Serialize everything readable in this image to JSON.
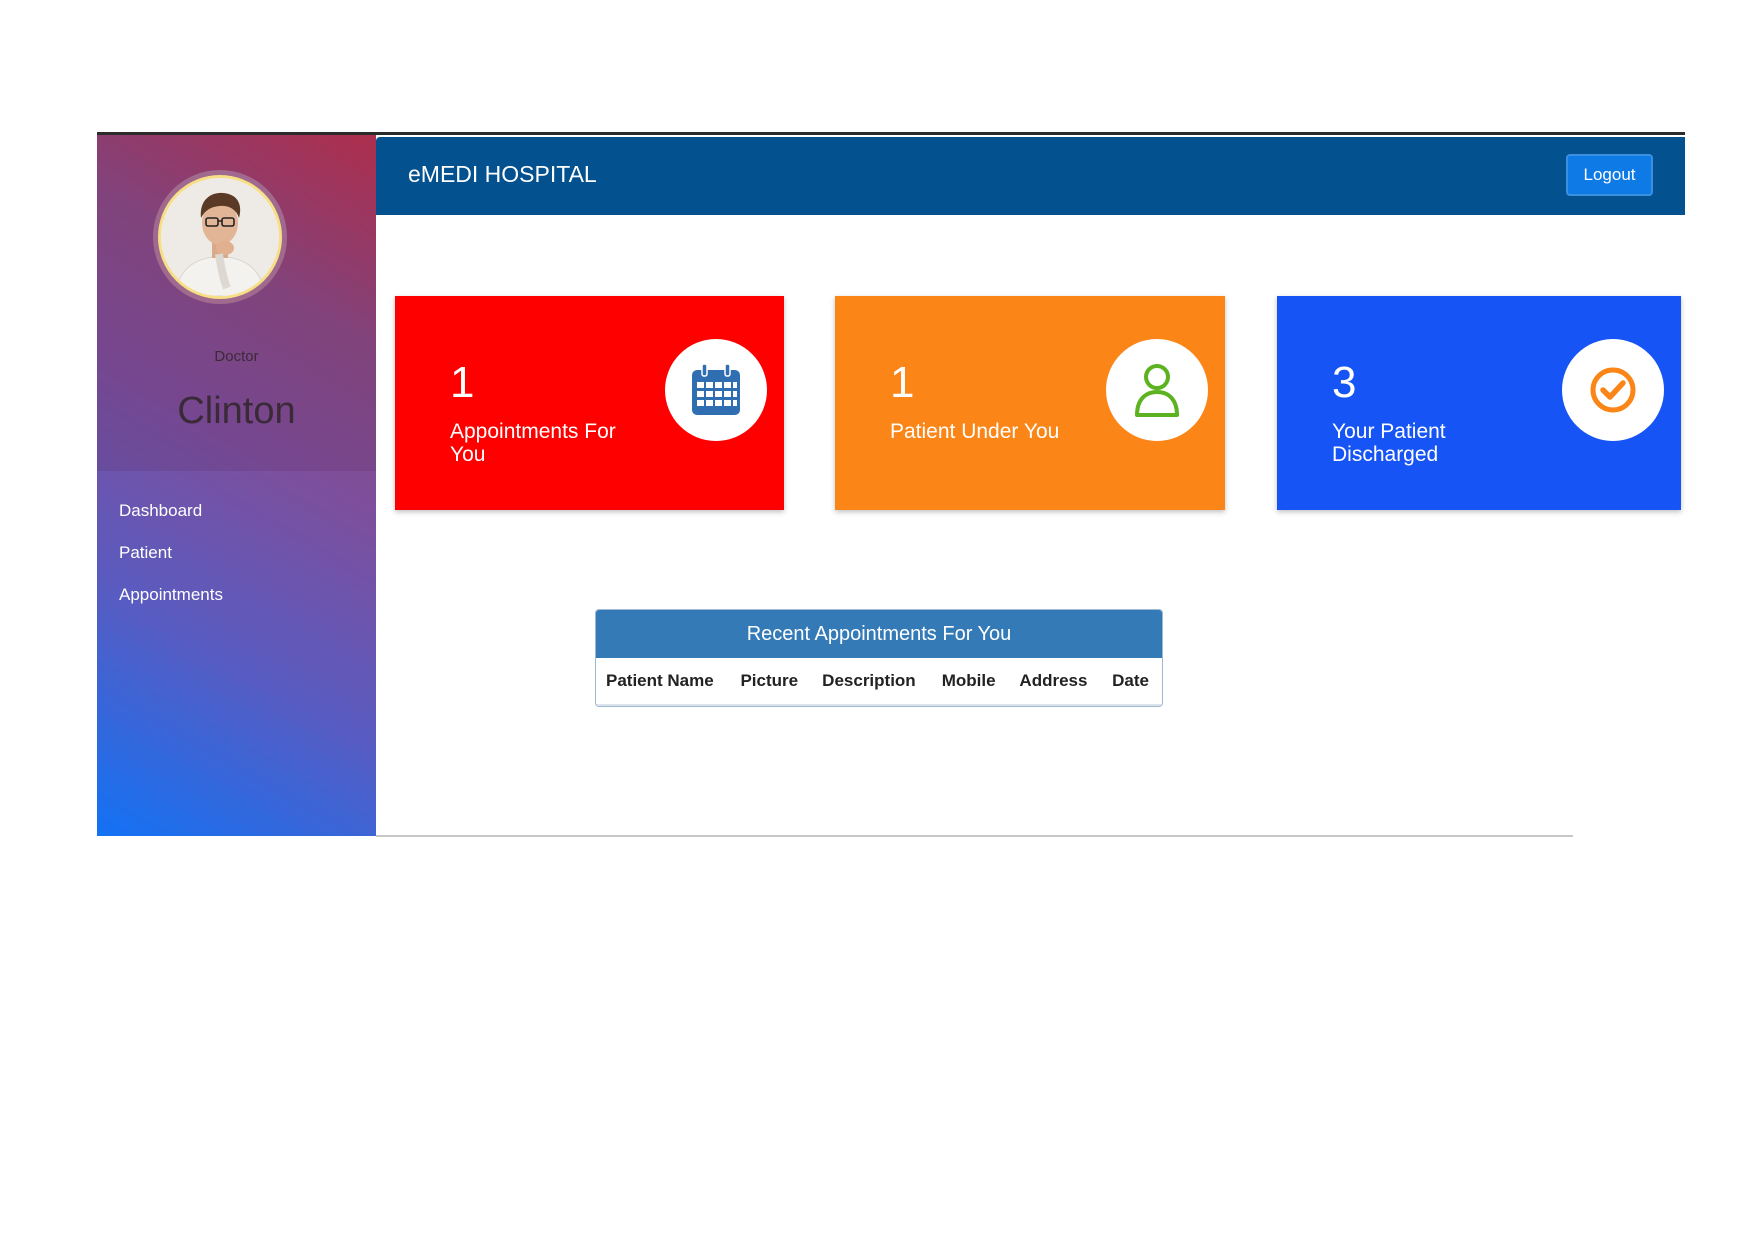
{
  "header": {
    "brand": "eMEDI HOSPITAL",
    "logout_label": "Logout"
  },
  "sidebar": {
    "role": "Doctor",
    "name": "Clinton",
    "items": [
      {
        "label": "Dashboard"
      },
      {
        "label": "Patient"
      },
      {
        "label": "Appointments"
      }
    ]
  },
  "stats": [
    {
      "count": "1",
      "label": "Appointments For You",
      "color": "#ff0000",
      "icon": "calendar-icon",
      "icon_color": "#2f6fb1"
    },
    {
      "count": "1",
      "label": "Patient Under You",
      "color": "#fb8516",
      "icon": "user-icon",
      "icon_color": "#5db31f"
    },
    {
      "count": "3",
      "label": "Your Patient Discharged",
      "color": "#1654f6",
      "icon": "check-circle-icon",
      "icon_color": "#fb8516"
    }
  ],
  "recent_appointments": {
    "title": "Recent Appointments For You",
    "columns": [
      "Patient Name",
      "Picture",
      "Description",
      "Mobile",
      "Address",
      "Date"
    ],
    "rows": []
  }
}
